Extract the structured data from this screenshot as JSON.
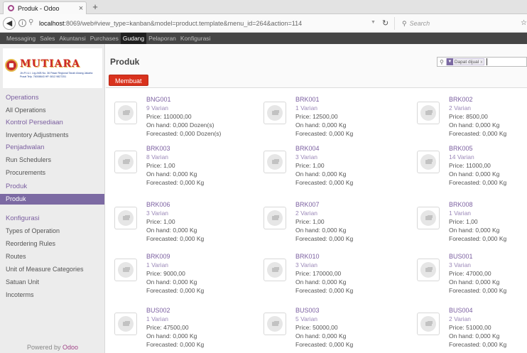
{
  "browser": {
    "tab_title": "Produk - Odoo",
    "tab_close": "×",
    "new_tab": "+",
    "url_host": "localhost",
    "url_rest": ":8069/web#view_type=kanban&model=product.template&menu_id=264&action=114",
    "search_placeholder": "Search"
  },
  "topmenu": [
    "Messaging",
    "Sales",
    "Akuntansi",
    "Purchases",
    "Gudang",
    "Pelaporan",
    "Konfigurasi"
  ],
  "topmenu_active": "Gudang",
  "logo": {
    "word": "MUTIARA",
    "address": "Jln.P.I.U.I. Lrg.AKB No. 36 Pasar Regional Tanah Abang Jakarta Pusat Telp. 76008643 HP. 0812 9827251"
  },
  "sidebar": {
    "sections": [
      {
        "title": "Operations",
        "items": [
          "All Operations"
        ]
      },
      {
        "title": "Kontrol Persediaan",
        "items": [
          "Inventory Adjustments"
        ]
      },
      {
        "title": "Penjadwalan",
        "items": [
          "Run Schedulers",
          "Procurements"
        ]
      },
      {
        "title": "Produk",
        "items": [
          "Produk"
        ]
      },
      {
        "title": "Konfigurasi",
        "items": [
          "Types of Operation",
          "Reordering Rules",
          "Routes",
          "Unit of Measure Categories",
          "Satuan Unit",
          "Incoterms"
        ]
      }
    ],
    "active_item": "Produk",
    "powered_prefix": "Powered by",
    "powered_brand": "Odoo"
  },
  "control_panel": {
    "title": "Produk",
    "create_label": "Membuat",
    "facet_label": "Dapat dijual",
    "facet_remove": "x"
  },
  "products": [
    {
      "code": "BNG001",
      "variants": "9 Varian",
      "price": "Price: 110000,00",
      "onhand": "On hand: 0,000 Dozen(s)",
      "forecast": "Forecasted: 0,000 Dozen(s)"
    },
    {
      "code": "BRK001",
      "variants": "1 Varian",
      "price": "Price: 12500,00",
      "onhand": "On hand: 0,000 Kg",
      "forecast": "Forecasted: 0,000 Kg"
    },
    {
      "code": "BRK002",
      "variants": "2 Varian",
      "price": "Price: 8500,00",
      "onhand": "On hand: 0,000 Kg",
      "forecast": "Forecasted: 0,000 Kg"
    },
    {
      "code": "BRK003",
      "variants": "8 Varian",
      "price": "Price: 1,00",
      "onhand": "On hand: 0,000 Kg",
      "forecast": "Forecasted: 0,000 Kg"
    },
    {
      "code": "BRK004",
      "variants": "3 Varian",
      "price": "Price: 1,00",
      "onhand": "On hand: 0,000 Kg",
      "forecast": "Forecasted: 0,000 Kg"
    },
    {
      "code": "BRK005",
      "variants": "14 Varian",
      "price": "Price: 11000,00",
      "onhand": "On hand: 0,000 Kg",
      "forecast": "Forecasted: 0,000 Kg"
    },
    {
      "code": "BRK006",
      "variants": "3 Varian",
      "price": "Price: 1,00",
      "onhand": "On hand: 0,000 Kg",
      "forecast": "Forecasted: 0,000 Kg"
    },
    {
      "code": "BRK007",
      "variants": "2 Varian",
      "price": "Price: 1,00",
      "onhand": "On hand: 0,000 Kg",
      "forecast": "Forecasted: 0,000 Kg"
    },
    {
      "code": "BRK008",
      "variants": "1 Varian",
      "price": "Price: 1,00",
      "onhand": "On hand: 0,000 Kg",
      "forecast": "Forecasted: 0,000 Kg"
    },
    {
      "code": "BRK009",
      "variants": "1 Varian",
      "price": "Price: 9000,00",
      "onhand": "On hand: 0,000 Kg",
      "forecast": "Forecasted: 0,000 Kg"
    },
    {
      "code": "BRK010",
      "variants": "3 Varian",
      "price": "Price: 170000,00",
      "onhand": "On hand: 0,000 Kg",
      "forecast": "Forecasted: 0,000 Kg"
    },
    {
      "code": "BUS001",
      "variants": "3 Varian",
      "price": "Price: 47000,00",
      "onhand": "On hand: 0,000 Kg",
      "forecast": "Forecasted: 0,000 Kg"
    },
    {
      "code": "BUS002",
      "variants": "1 Varian",
      "price": "Price: 47500,00",
      "onhand": "On hand: 0,000 Kg",
      "forecast": "Forecasted: 0,000 Kg"
    },
    {
      "code": "BUS003",
      "variants": "5 Varian",
      "price": "Price: 50000,00",
      "onhand": "On hand: 0,000 Kg",
      "forecast": "Forecasted: 0,000 Kg"
    },
    {
      "code": "BUS004",
      "variants": "2 Varian",
      "price": "Price: 51000,00",
      "onhand": "On hand: 0,000 Kg",
      "forecast": "Forecasted: 0,000 Kg"
    }
  ]
}
